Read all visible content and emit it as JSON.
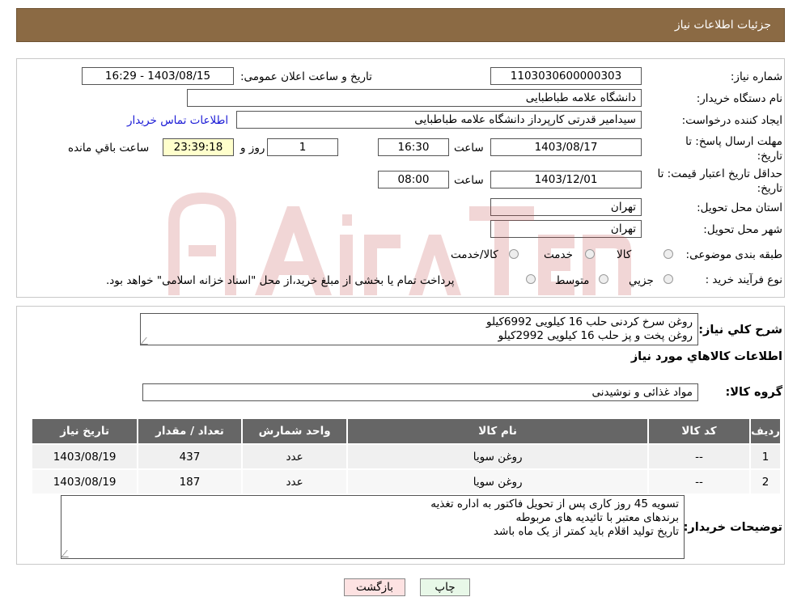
{
  "header": {
    "title": "جزئیات اطلاعات نیاز"
  },
  "form": {
    "need_number_label": "شماره نیاز:",
    "need_number": "1103030600000303",
    "announce_label": "تاریخ و ساعت اعلان عمومی:",
    "announce_value": "1403/08/15 - 16:29",
    "buyer_org_label": "نام دستگاه خریدار:",
    "buyer_org": "دانشگاه علامه طباطبایی",
    "creator_label": "ایجاد کننده درخواست:",
    "creator": "سیدامیر قدرتی کارپرداز دانشگاه علامه طباطبایی",
    "contact_link": "اطلاعات تماس خریدار",
    "deadline_label_1": "مهلت ارسال پاسخ: تا",
    "deadline_label_2": "تاریخ:",
    "deadline_date": "1403/08/17",
    "time_word": "ساعت",
    "deadline_time": "16:30",
    "days_value": "1",
    "days_word": "روز و",
    "remaining_time": "23:39:18",
    "remaining_word": "ساعت باقي مانده",
    "validity_label_1": "حداقل تاریخ اعتبار قیمت: تا",
    "validity_label_2": "تاریخ:",
    "validity_date": "1403/12/01",
    "validity_time": "08:00",
    "province_label": "استان محل تحویل:",
    "province": "تهران",
    "city_label": "شهر محل تحویل:",
    "city": "تهران",
    "category_label": "طبقه بندی موضوعی:",
    "category_options": [
      "کالا",
      "خدمت",
      "کالا/خدمت"
    ],
    "process_label": "نوع فرآیند خرید :",
    "process_options": [
      "جزیي",
      "متوسط"
    ],
    "process_note": "پرداخت تمام یا بخشی از مبلغ خرید،از محل \"اسناد خزانه اسلامی\" خواهد بود."
  },
  "description": {
    "label": "شرح كلي نياز:",
    "lines": [
      "روغن سرخ کردنی حلب 16 کیلویی  6992کیلو",
      "روغن پخت و پز     حلب 16 کیلویی   2992کیلو"
    ]
  },
  "goods": {
    "section_title": "اطلاعات کالاهاي مورد نياز",
    "group_label": "گروه کالا:",
    "group_value": "مواد غذائی و نوشیدنی",
    "columns": [
      "رديف",
      "کد کالا",
      "نام کالا",
      "واحد شمارش",
      "تعداد / مقدار",
      "تاريخ نياز"
    ],
    "rows": [
      [
        "1",
        "--",
        "روغن سویا",
        "عدد",
        "437",
        "1403/08/19"
      ],
      [
        "2",
        "--",
        "روغن سویا",
        "عدد",
        "187",
        "1403/08/19"
      ]
    ]
  },
  "buyer_notes": {
    "label": "توضیحات خریدار:",
    "lines": [
      "تسویه 45 روز کاری پس از تحویل فاکتور به اداره تغذیه",
      "برندهای معتبر با تائیدیه های مربوطه",
      "تاریخ تولید اقلام باید کمتر از یک ماه باشد"
    ]
  },
  "buttons": {
    "print": "چاپ",
    "back": "بازگشت"
  },
  "colors": {
    "header_bg": "#8b6a44",
    "table_header_bg": "#666666",
    "remaining_bg": "#ffffcc",
    "back_button_bg": "#fde2e2",
    "print_button_bg": "#e8f8e8"
  }
}
